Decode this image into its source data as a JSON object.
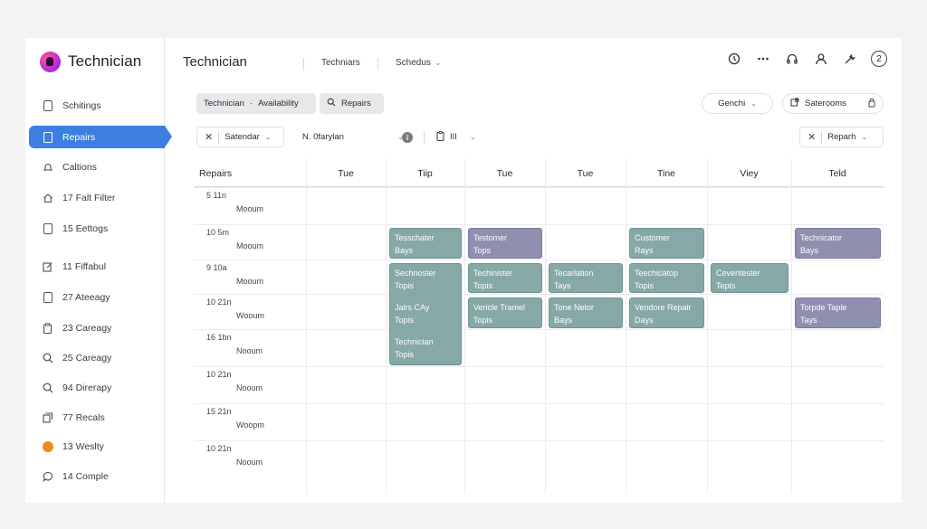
{
  "app": {
    "name": "Technician"
  },
  "sidebar": {
    "items": [
      {
        "label": "Schitings",
        "icon": "document-icon"
      },
      {
        "label": "Repairs",
        "icon": "document-icon",
        "active": true
      },
      {
        "label": "Caltions",
        "icon": "bell-icon"
      },
      {
        "label": "17 Falt Filter",
        "icon": "home-icon"
      },
      {
        "label": "15 Eettogs",
        "icon": "document-icon"
      },
      {
        "label": "11 Fiffabul",
        "icon": "edit-icon"
      },
      {
        "label": "27 Ateeagy",
        "icon": "document-icon"
      },
      {
        "label": "23 Careagy",
        "icon": "clipboard-icon"
      },
      {
        "label": "25 Careagy",
        "icon": "search-icon"
      },
      {
        "label": "94 Direrapy",
        "icon": "search-icon"
      },
      {
        "label": "77 Recals",
        "icon": "copy-icon"
      },
      {
        "label": "13 Weslty",
        "icon": "orange-dot-icon"
      },
      {
        "label": "14 Comple",
        "icon": "chat-icon"
      }
    ]
  },
  "header": {
    "title": "Technician",
    "links": [
      {
        "label": "Techniars"
      },
      {
        "label": "Schedus",
        "has_dropdown": true
      }
    ],
    "icons": [
      "clock-icon",
      "more-icon",
      "headset-icon",
      "user-icon",
      "wrench-icon"
    ],
    "badge": "2"
  },
  "toolbar": {
    "tech_availability": {
      "part1": "Technician",
      "sep": "·",
      "part2": "Availability"
    },
    "repairs_label": "Repairs",
    "genchi_label": "Genchi",
    "saterooms_label": "Saterooms",
    "satendar_label": "Satendar",
    "ofarylan_label": "N. 0farylan",
    "view_label": "III",
    "reparh_label": "Reparh"
  },
  "calendar": {
    "corner_label": "Repairs",
    "columns": [
      "Tue",
      "Tiip",
      "Tue",
      "Tue",
      "Tine",
      "Viey",
      "Teld"
    ],
    "rows": [
      {
        "time": "5  11n",
        "sub": "Mooum"
      },
      {
        "time": "10  5m",
        "sub": "Mooum"
      },
      {
        "time": "9  10a",
        "sub": "Mooum"
      },
      {
        "time": "10  21n",
        "sub": "Wooum"
      },
      {
        "time": "16  1bn",
        "sub": "Nooum"
      },
      {
        "time": "10  21n",
        "sub": "Nooum"
      },
      {
        "time": "15  21n",
        "sub": "Woopm"
      },
      {
        "time": "10  21n",
        "sub": "Nooum"
      }
    ],
    "events": [
      {
        "col": 0,
        "row": 1,
        "span": 1,
        "color": "teal",
        "lines": [
          "Tesschater",
          "Bays"
        ]
      },
      {
        "col": 1,
        "row": 1,
        "span": 1,
        "color": "purple",
        "lines": [
          "Testomer",
          "Tops"
        ]
      },
      {
        "col": 3,
        "row": 1,
        "span": 1,
        "color": "teal",
        "lines": [
          "Customer",
          "Rays"
        ]
      },
      {
        "col": 5,
        "row": 1,
        "span": 1,
        "color": "purple",
        "lines": [
          "Technicator",
          "Bays"
        ]
      },
      {
        "col": 0,
        "row": 2,
        "span": 3,
        "color": "teal",
        "lines": [
          "Sechnoster",
          "Topis",
          "",
          "Jalrs CAy",
          "Topis",
          "",
          "Technician",
          "Topis"
        ]
      },
      {
        "col": 1,
        "row": 2,
        "span": 1,
        "color": "teal",
        "lines": [
          "Techinister",
          "Topis"
        ]
      },
      {
        "col": 2,
        "row": 2,
        "span": 1,
        "color": "teal",
        "lines": [
          "Tecarlation",
          "Tays"
        ]
      },
      {
        "col": 3,
        "row": 2,
        "span": 1,
        "color": "teal",
        "lines": [
          "Teechicatop",
          "Topis"
        ]
      },
      {
        "col": 4,
        "row": 2,
        "span": 1,
        "color": "teal",
        "lines": [
          "Ceventester",
          "Tepts"
        ]
      },
      {
        "col": 1,
        "row": 3,
        "span": 1,
        "color": "teal",
        "lines": [
          "Vericle Tramel",
          "Topis"
        ]
      },
      {
        "col": 2,
        "row": 3,
        "span": 1,
        "color": "teal",
        "lines": [
          "Tone Netor",
          "Bays"
        ]
      },
      {
        "col": 3,
        "row": 3,
        "span": 1,
        "color": "teal",
        "lines": [
          "Vendore Repair",
          "Days"
        ]
      },
      {
        "col": 5,
        "row": 3,
        "span": 1,
        "color": "purple",
        "lines": [
          "Torpde Taple",
          "Tays"
        ]
      }
    ]
  }
}
